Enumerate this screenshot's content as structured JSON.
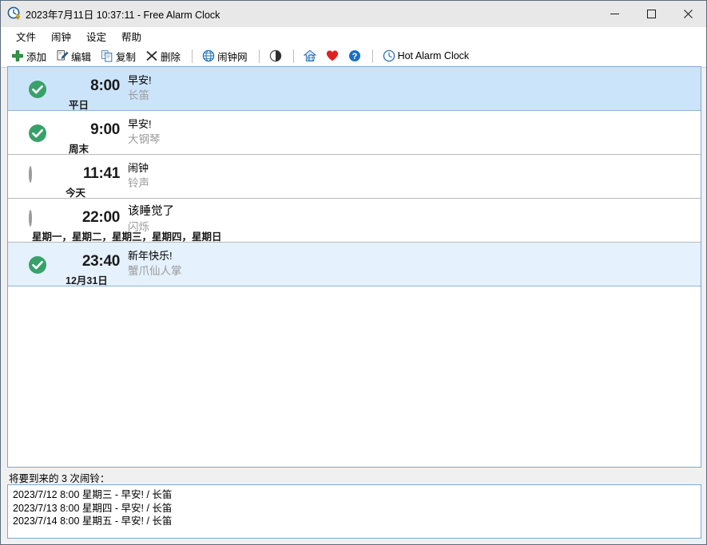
{
  "window": {
    "title": "2023年7月11日 10:37:11 - Free Alarm Clock",
    "app_icon": "clock-bell-icon",
    "minimize_label": "—",
    "maximize_label": "☐",
    "close_label": "✕",
    "colors": {
      "titlebar_bg": "#e8e8e8",
      "border": "#5a6b80",
      "selection_strong": "#cce4fa",
      "selection_light": "#e5f1fc",
      "check_green": "#38a169",
      "accent_blue": "#1a6fc4"
    }
  },
  "menubar": {
    "items": [
      {
        "label": "文件",
        "name": "menu-file"
      },
      {
        "label": "闹钟",
        "name": "menu-alarm"
      },
      {
        "label": "设定",
        "name": "menu-settings"
      },
      {
        "label": "帮助",
        "name": "menu-help"
      }
    ]
  },
  "toolbar": {
    "buttons": [
      {
        "label": "添加",
        "icon": "plus-icon",
        "name": "toolbar-add"
      },
      {
        "label": "编辑",
        "icon": "edit-pencil-icon",
        "name": "toolbar-edit"
      },
      {
        "label": "复制",
        "icon": "copy-icon",
        "name": "toolbar-copy"
      },
      {
        "label": "删除",
        "icon": "delete-x-icon",
        "name": "toolbar-delete"
      },
      {
        "label": "闹钟网",
        "icon": "globe-icon",
        "name": "toolbar-alarm-web"
      },
      {
        "label": "",
        "icon": "contrast-circle-icon",
        "name": "toolbar-contrast"
      },
      {
        "label": "",
        "icon": "home-globe-icon",
        "name": "toolbar-homepage"
      },
      {
        "label": "",
        "icon": "heart-icon",
        "name": "toolbar-donate"
      },
      {
        "label": "",
        "icon": "question-help-icon",
        "name": "toolbar-help"
      },
      {
        "label": "Hot Alarm Clock",
        "icon": "clock-outline-icon",
        "name": "toolbar-hot-alarm-clock"
      }
    ]
  },
  "alarms": [
    {
      "enabled": true,
      "selected": "strong",
      "time": "8:00",
      "days": "平日",
      "title": "早安!",
      "sound": "长笛",
      "check_icon": "check-circle-icon"
    },
    {
      "enabled": true,
      "selected": "none",
      "time": "9:00",
      "days": "周末",
      "title": "早安!",
      "sound": "大钢琴",
      "check_icon": "check-circle-icon"
    },
    {
      "enabled": false,
      "selected": "none",
      "time": "11:41",
      "days": "今天",
      "title": "闹钟",
      "sound": "铃声",
      "check_icon": "empty-circle-icon"
    },
    {
      "enabled": false,
      "selected": "none",
      "time": "22:00",
      "days": "星期一，星期二，星期三，星期四，星期日",
      "title": "该睡觉了",
      "sound": "闪烁",
      "check_icon": "empty-circle-icon"
    },
    {
      "enabled": true,
      "selected": "light",
      "time": "23:40",
      "days": "12月31日",
      "title": "新年快乐!",
      "sound": "蟹爪仙人掌",
      "check_icon": "check-circle-icon"
    }
  ],
  "upcoming": {
    "label": "将要到来的 3 次闹铃：",
    "items": [
      "2023/7/12 8:00 星期三 - 早安! / 长笛",
      "2023/7/13 8:00 星期四 - 早安! / 长笛",
      "2023/7/14 8:00 星期五 - 早安! / 长笛"
    ]
  }
}
